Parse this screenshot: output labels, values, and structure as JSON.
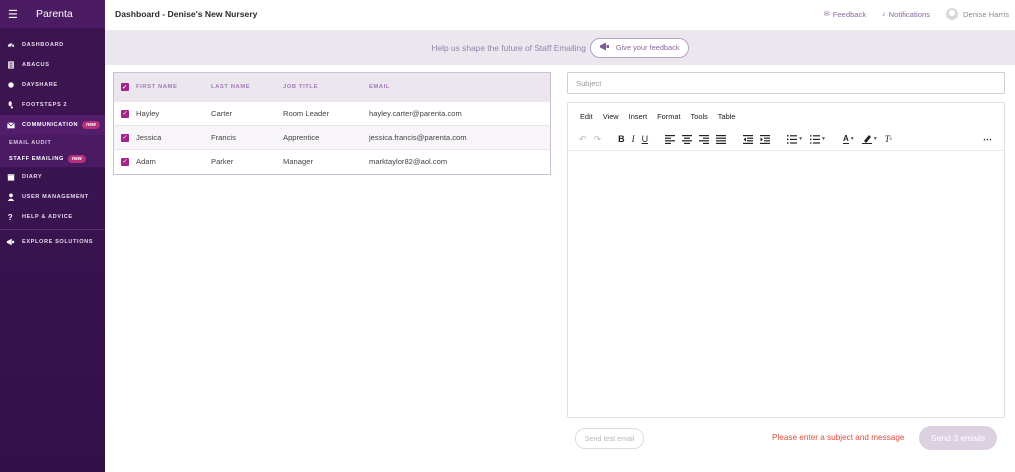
{
  "app": {
    "brand": "Parenta",
    "page_title": "Dashboard - Denise's New Nursery"
  },
  "topbar": {
    "feedback": "Feedback",
    "notifications": "Notifications",
    "user": "Denise Harris"
  },
  "sidebar": {
    "items": [
      {
        "label": "DASHBOARD",
        "icon": "dashboard-icon"
      },
      {
        "label": "ABACUS",
        "icon": "abacus-icon"
      },
      {
        "label": "DAYSHARE",
        "icon": "dayshare-icon"
      },
      {
        "label": "FOOTSTEPS 2",
        "icon": "footsteps-icon"
      },
      {
        "label": "COMMUNICATION",
        "icon": "envelope-icon",
        "badge": "new"
      },
      {
        "label": "DIARY",
        "icon": "diary-icon"
      },
      {
        "label": "USER MANAGEMENT",
        "icon": "user-icon"
      },
      {
        "label": "HELP & ADVICE",
        "icon": "question-icon"
      },
      {
        "label": "EXPLORE SOLUTIONS",
        "icon": "megaphone-icon"
      }
    ],
    "sub_items": [
      {
        "label": "EMAIL AUDIT"
      },
      {
        "label": "STAFF EMAILING",
        "badge": "new"
      }
    ]
  },
  "banner": {
    "text": "Help us shape the future of Staff Emailing",
    "button": "Give your feedback"
  },
  "staff_table": {
    "headers": {
      "first": "FIRST NAME",
      "last": "LAST NAME",
      "job": "JOB TITLE",
      "email": "EMAIL"
    },
    "rows": [
      {
        "first": "Hayley",
        "last": "Carter",
        "job": "Room Leader",
        "email": "hayley.carter@parenta.com"
      },
      {
        "first": "Jessica",
        "last": "Francis",
        "job": "Apprentice",
        "email": "jessica.francis@parenta.com"
      },
      {
        "first": "Adam",
        "last": "Parker",
        "job": "Manager",
        "email": "marktaylor82@aol.com"
      }
    ]
  },
  "subject": {
    "placeholder": "Subject",
    "value": ""
  },
  "editor": {
    "menus": [
      "Edit",
      "View",
      "Insert",
      "Format",
      "Tools",
      "Table"
    ]
  },
  "actions": {
    "send_test": "Send test email",
    "warning": "Please enter a subject and message",
    "send": "Send 3 emails"
  },
  "colors": {
    "sidebar": "#3d1550",
    "accent": "#a3248a",
    "warning": "#e04a3b",
    "send_disabled": "#dcd1e1"
  }
}
